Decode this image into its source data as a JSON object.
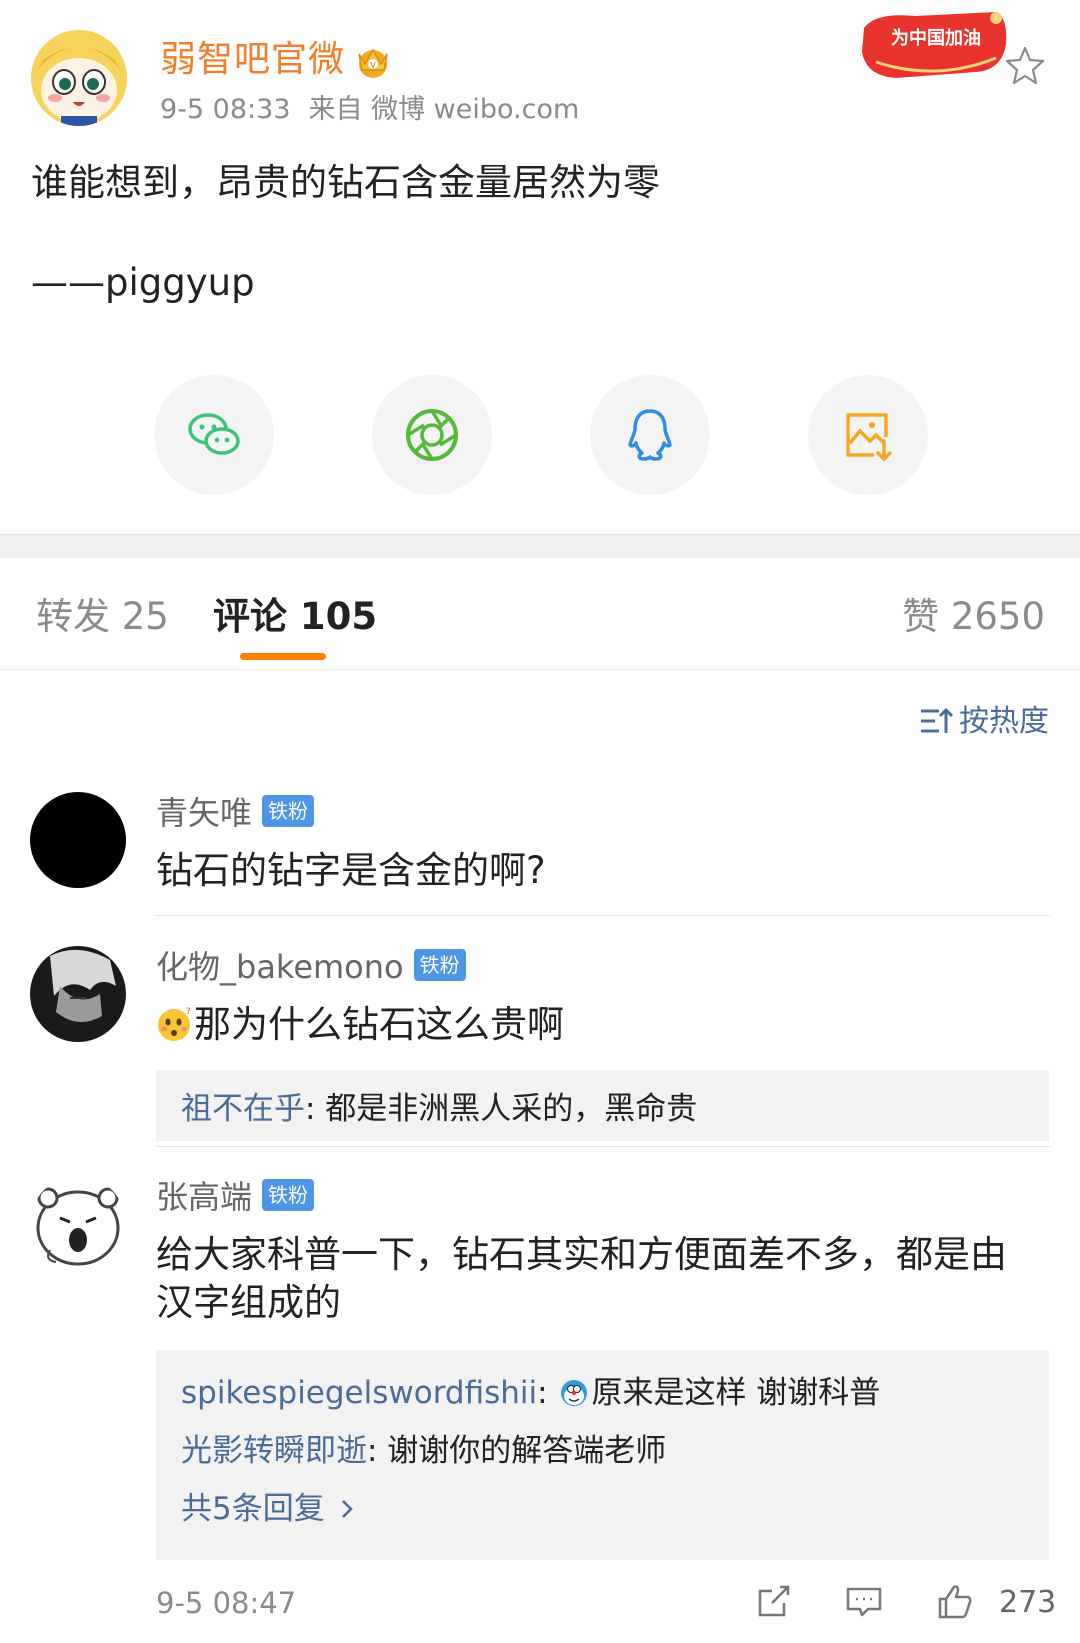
{
  "post": {
    "author": "弱智吧官微",
    "time": "9-5 08:33",
    "source": "来自 微博 weibo.com",
    "badge_text": "为中国加油",
    "text": "谁能想到，昂贵的钻石含金量居然为零",
    "signature": "——piggyup"
  },
  "share": [
    "wechat-icon",
    "moments-icon",
    "qq-icon",
    "save-image-icon"
  ],
  "tabs": {
    "repost": "转发 25",
    "comment": "评论 105",
    "like": "赞 2650"
  },
  "sort_label": "按热度",
  "comments": [
    {
      "name": "青矢唯",
      "fan_badge": "铁粉",
      "text": "钻石的钻字是含金的啊?"
    },
    {
      "name": "化物_bakemono",
      "fan_badge": "铁粉",
      "text": "那为什么钻石这么贵啊",
      "replies": [
        {
          "user": "祖不在乎",
          "text": ": 都是非洲黑人采的，黑命贵"
        }
      ]
    },
    {
      "name": "张高端",
      "fan_badge": "铁粉",
      "text_line1": "给大家科普一下，钻石其实和方便面差不多，都是由",
      "text_line2": "汉字组成的",
      "replies": [
        {
          "user": "spikespiegelswordfishii",
          "text": "原来是这样 谢谢科普",
          "sep": ": "
        },
        {
          "user": "光影转瞬即逝",
          "text": ": 谢谢你的解答端老师"
        }
      ],
      "more_replies": "共5条回复",
      "time": "9-5 08:47",
      "likes": "273"
    }
  ],
  "colors": {
    "author": "#f37e28",
    "link": "#4a6c98",
    "tab_underline": "#ff8200",
    "fan_badge": "#4d95e6"
  }
}
